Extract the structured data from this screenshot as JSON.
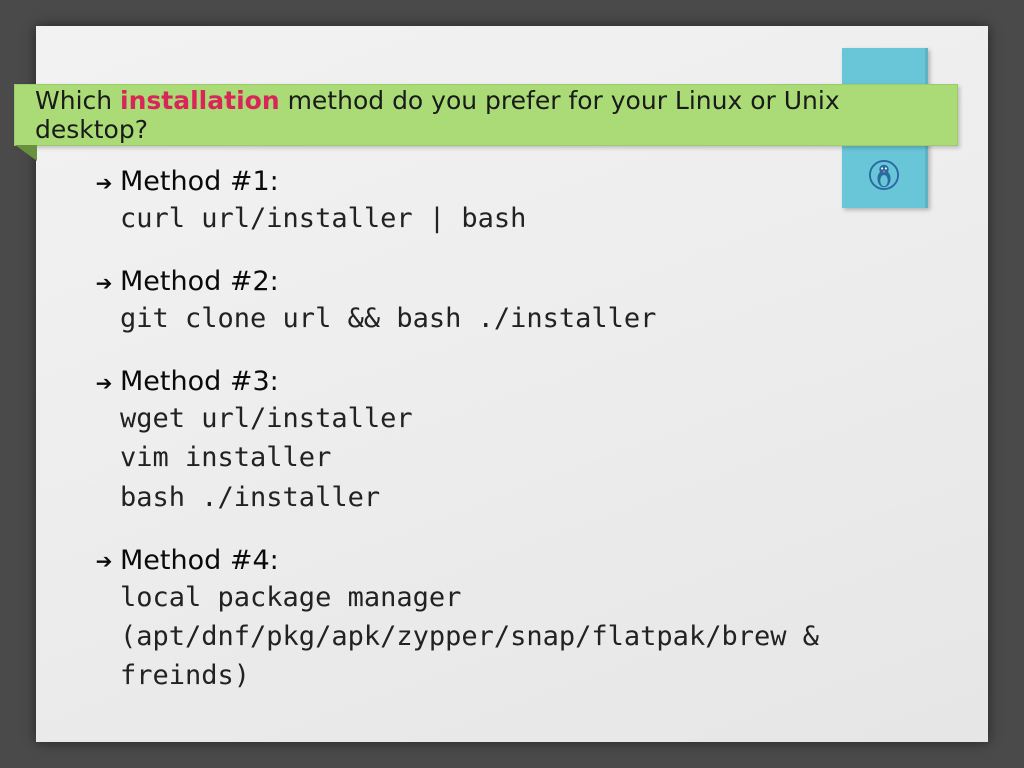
{
  "title": {
    "before": "Which ",
    "highlight": "installation",
    "after": " method do you prefer for your Linux or Unix desktop?"
  },
  "methods": [
    {
      "label": "Method #1:",
      "code": "curl url/installer | bash"
    },
    {
      "label": "Method #2:",
      "code": "git clone url && bash ./installer"
    },
    {
      "label": "Method #3:",
      "code": "wget url/installer\nvim installer\nbash ./installer"
    },
    {
      "label": "Method #4:",
      "code": "local package manager\n(apt/dnf/pkg/apk/zypper/snap/flatpak/brew & freinds)"
    }
  ]
}
